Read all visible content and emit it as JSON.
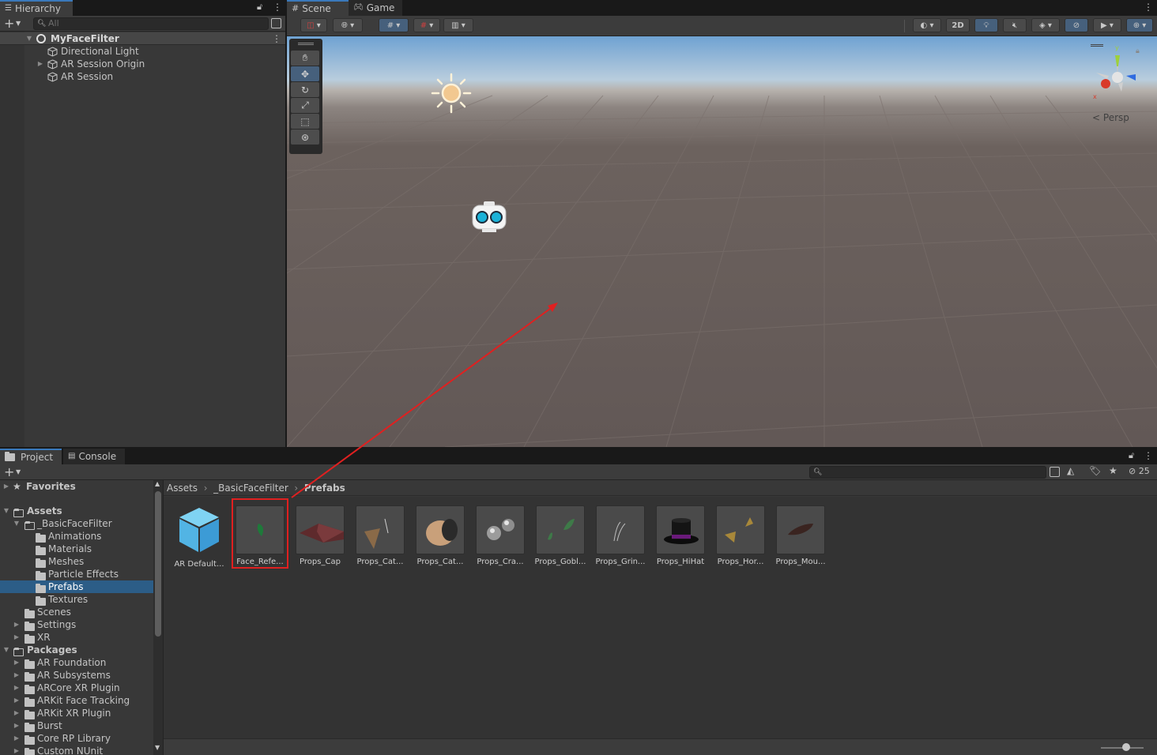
{
  "hierarchy": {
    "tab_label": "Hierarchy",
    "search_placeholder": "All",
    "scene_name": "MyFaceFilter",
    "items": [
      "Directional Light",
      "AR Session Origin",
      "AR Session"
    ]
  },
  "scene_view": {
    "tabs": [
      "Scene",
      "Game"
    ],
    "btn_2d": "2D",
    "persp_label": "Persp",
    "gizmo_x": "x",
    "gizmo_y": "y"
  },
  "project": {
    "tabs": [
      "Project",
      "Console"
    ],
    "favorites_label": "Favorites",
    "assets_label": "Assets",
    "assets_tree": [
      "_BasicFaceFilter",
      "Animations",
      "Materials",
      "Meshes",
      "Particle Effects",
      "Prefabs",
      "Textures",
      "Scenes",
      "Settings",
      "XR"
    ],
    "packages_label": "Packages",
    "packages_tree": [
      "AR Foundation",
      "AR Subsystems",
      "ARCore XR Plugin",
      "ARKit Face Tracking",
      "ARKit XR Plugin",
      "Burst",
      "Core RP Library",
      "Custom NUnit"
    ],
    "breadcrumb": [
      "Assets",
      "_BasicFaceFilter",
      "Prefabs"
    ],
    "hidden_count": "25",
    "search_placeholder": "",
    "assets": [
      "AR Default...",
      "Face_Refe...",
      "Props_Cap",
      "Props_Cat...",
      "Props_Cat...",
      "Props_Cra...",
      "Props_Gobl...",
      "Props_Grin...",
      "Props_HiHat",
      "Props_Hor...",
      "Props_Mou..."
    ],
    "selected_asset_index": 1
  },
  "colors": {
    "accent": "#3a79bb",
    "selection": "#2c5d87",
    "annotation": "#e02020",
    "gizmo_y": "#9ed03a",
    "gizmo_x": "#d83a2a",
    "gizmo_z": "#2f6be0"
  }
}
